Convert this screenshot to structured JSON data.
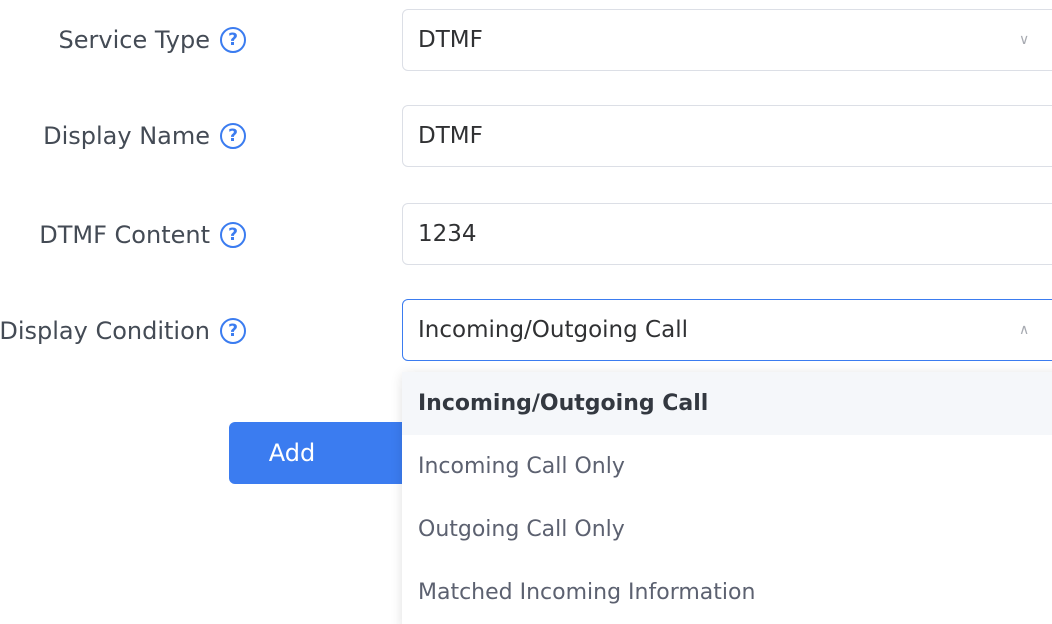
{
  "form": {
    "service_type": {
      "label": "Service Type",
      "value": "DTMF"
    },
    "display_name": {
      "label": "Display Name",
      "value": "DTMF"
    },
    "dtmf_content": {
      "label": "DTMF Content",
      "value": "1234"
    },
    "display_condition": {
      "label": "Display Condition",
      "value": "Incoming/Outgoing Call"
    },
    "help_glyph": "?",
    "chevron_down": "∨",
    "chevron_up": "∧"
  },
  "add_button": {
    "label": "Add"
  },
  "dropdown": {
    "options": [
      "Incoming/Outgoing Call",
      "Incoming Call Only",
      "Outgoing Call Only",
      "Matched Incoming Information"
    ],
    "selected_index": 0
  },
  "colors": {
    "accent": "#3b7cf0",
    "border": "#dcdfe6",
    "selected_bg": "#f5f7fa"
  }
}
